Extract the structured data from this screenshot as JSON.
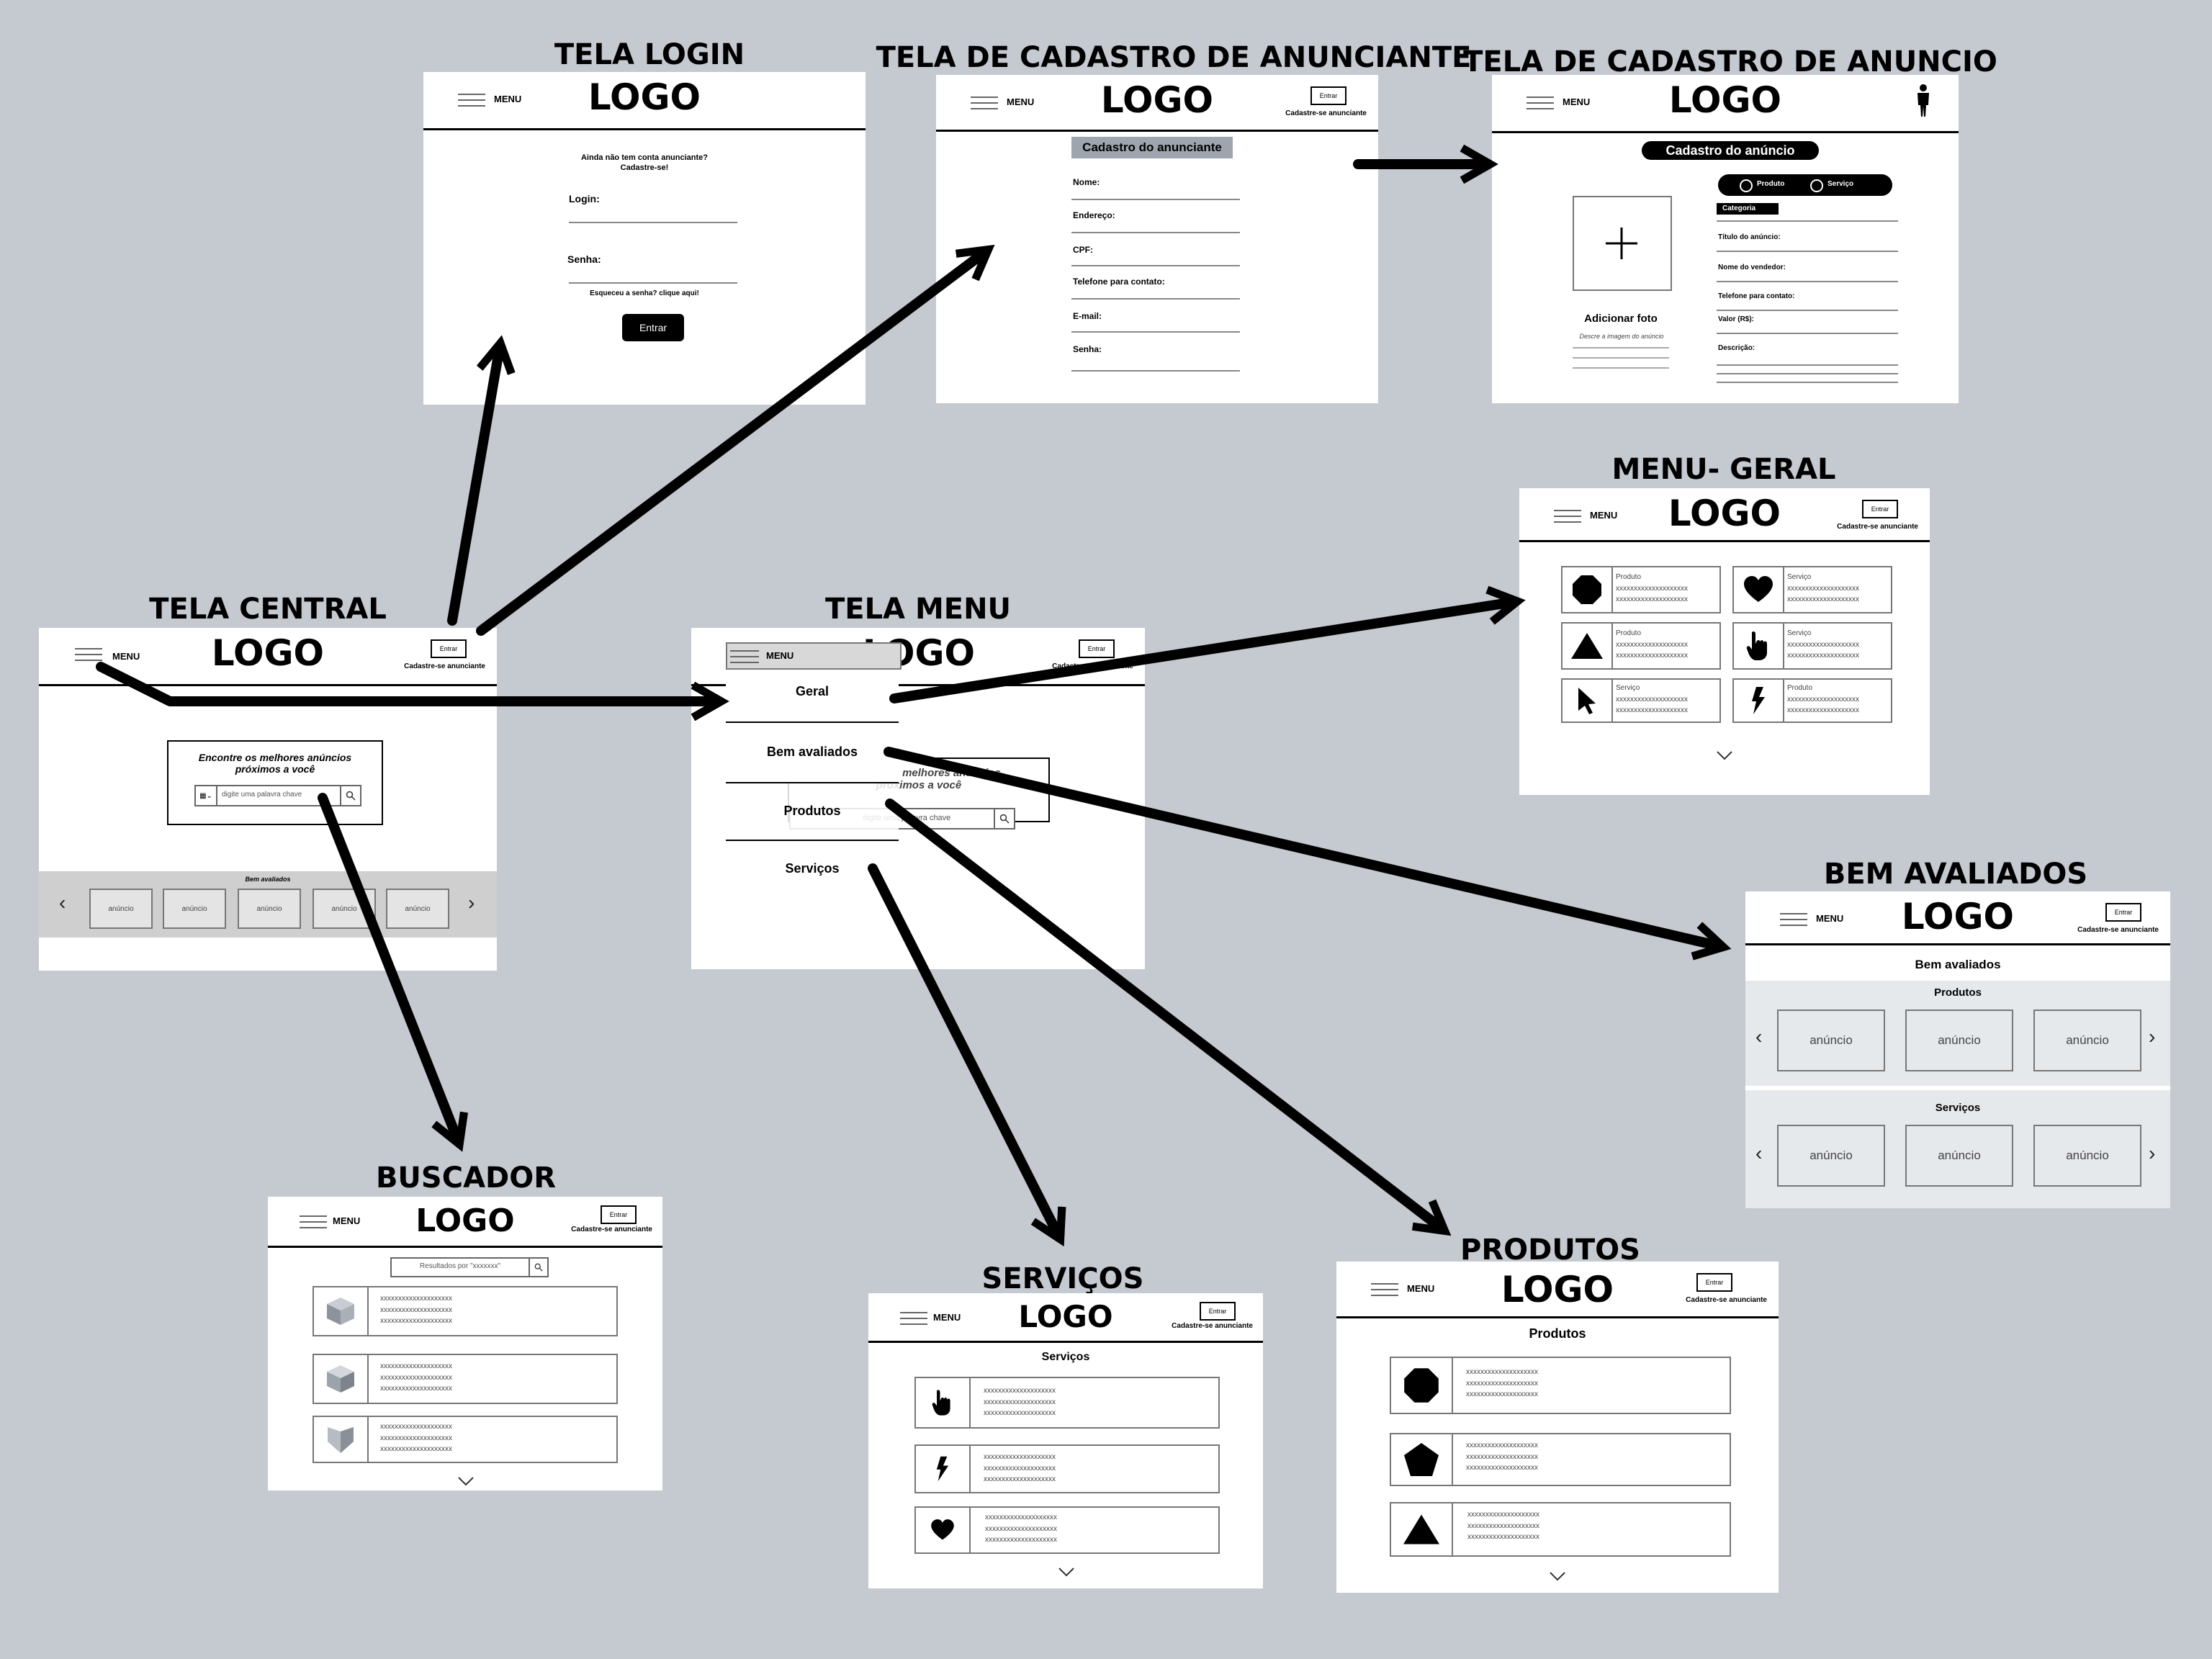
{
  "common": {
    "menu_label": "MENU",
    "logo": "LOGO",
    "enter_label": "Entrar",
    "register_label": "Cadastre-se anunciante",
    "placeholder_x": "xxxxxxxxxxxxxxxxxxxx",
    "anuncio": "anúncio"
  },
  "titles": {
    "login": "TELA LOGIN",
    "cadastro_anunciante": "TELA DE CADASTRO DE ANUNCIANTE",
    "cadastro_anuncio": "TELA DE CADASTRO DE ANUNCIO",
    "menu_geral": "MENU- GERAL",
    "central": "TELA CENTRAL",
    "menu": "TELA MENU",
    "bem_avaliados": "BEM AVALIADOS",
    "buscador": "BUSCADOR",
    "servicos": "SERVIÇOS",
    "produtos": "PRODUTOS"
  },
  "login": {
    "prompt_line1": "Ainda não tem conta anunciante?",
    "prompt_line2": "Cadastre-se!",
    "login_label": "Login:",
    "password_label": "Senha:",
    "forgot": "Esqueceu a senha? clique aqui!",
    "submit": "Entrar"
  },
  "cadastro_anunciante": {
    "heading": "Cadastro do anunciante",
    "fields": [
      "Nome:",
      "Endereço:",
      "CPF:",
      "Telefone para contato:",
      "E-mail:",
      "Senha:"
    ]
  },
  "cadastro_anuncio": {
    "heading": "Cadastro do anúncio",
    "option_product": "Produto",
    "option_service": "Serviço",
    "category": "Categoria",
    "photo_label": "Adicionar foto",
    "photo_hint": "Descre a imagem do anúncio",
    "fields": [
      "Título do anúncio:",
      "Nome do vendedor:",
      "Telefone para contato:",
      "Valor (R$):",
      "Descrição:"
    ]
  },
  "central": {
    "search_heading_line1": "Encontre os melhores anúncios",
    "search_heading_line2": "próximos a você",
    "search_placeholder": "digite uma palavra chave",
    "bem_avaliados_label": "Bem avaliados"
  },
  "menu_screen": {
    "items": [
      "Geral",
      "Bem avaliados",
      "Produtos",
      "Serviços"
    ],
    "bg_heading_line1": "Encontre os melhores anúncios",
    "bg_heading_line2": "próximos a você",
    "bg_placeholder": "digite uma palavra chave"
  },
  "menu_geral": {
    "items": [
      {
        "icon": "octagon-icon",
        "kind": "Produto"
      },
      {
        "icon": "heart-icon",
        "kind": "Serviço"
      },
      {
        "icon": "triangle-icon",
        "kind": "Produto"
      },
      {
        "icon": "hand-pointer-icon",
        "kind": "Serviço"
      },
      {
        "icon": "cursor-arrow-icon",
        "kind": "Serviço"
      },
      {
        "icon": "lightning-icon",
        "kind": "Produto"
      }
    ]
  },
  "bem_avaliados": {
    "heading": "Bem avaliados",
    "products_label": "Produtos",
    "services_label": "Serviços"
  },
  "buscador": {
    "results": "Resultados por \"xxxxxxx\""
  },
  "servicos": {
    "heading": "Serviços"
  },
  "produtos": {
    "heading": "Produtos"
  }
}
